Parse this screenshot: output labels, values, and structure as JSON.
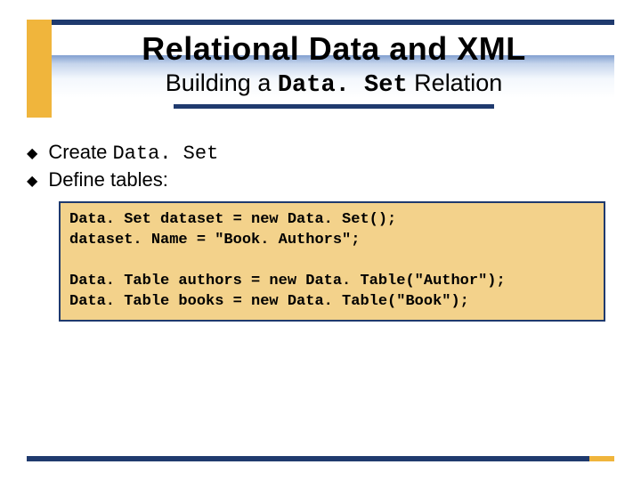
{
  "header": {
    "title": "Relational Data and XML",
    "subtitle_prefix": "Building a ",
    "subtitle_mono": "Data. Set",
    "subtitle_suffix": " Relation"
  },
  "bullets": [
    {
      "prefix": "Create ",
      "mono": "Data. Set",
      "suffix": ""
    },
    {
      "prefix": "Define tables:",
      "mono": "",
      "suffix": ""
    }
  ],
  "code": "Data. Set dataset = new Data. Set();\ndataset. Name = \"Book. Authors\";\n\nData. Table authors = new Data. Table(\"Author\");\nData. Table books = new Data. Table(\"Book\");"
}
